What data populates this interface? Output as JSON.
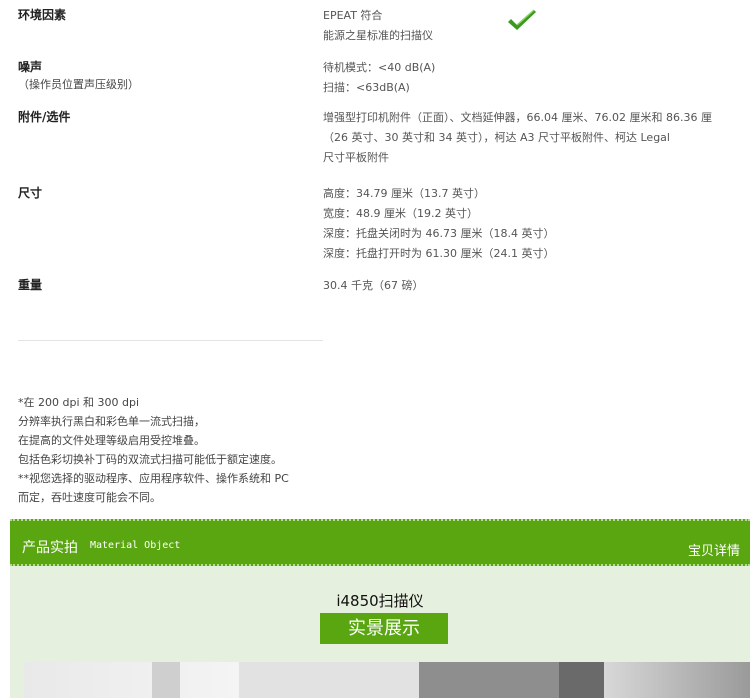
{
  "specs": {
    "env": {
      "label": "环境因素",
      "lines": [
        "EPEAT 符合",
        "能源之星标准的扫描仪"
      ],
      "icon": "checkmark-icon",
      "icon_color": "#3a9a1e"
    },
    "noise": {
      "label": "噪声",
      "sublabel": "（操作员位置声压级别）",
      "lines": [
        "待机模式：<40 dB(A)",
        "扫描：<63dB(A)"
      ]
    },
    "accessories": {
      "label": "附件/选件",
      "lines": [
        "增强型打印机附件（正面）、文档延伸器，66.04 厘米、76.02 厘米和 86.36 厘",
        "（26 英寸、30 英寸和 34 英寸），柯达 A3 尺寸平板附件、柯达 Legal",
        "尺寸平板附件"
      ]
    },
    "dimensions": {
      "label": "尺寸",
      "lines": [
        "高度：34.79 厘米（13.7 英寸）",
        "宽度：48.9 厘米（19.2 英寸）",
        "深度：托盘关闭时为 46.73 厘米（18.4 英寸）",
        "深度：托盘打开时为 61.30 厘米（24.1 英寸）"
      ]
    },
    "weight": {
      "label": "重量",
      "lines": [
        "30.4 千克（67 磅）"
      ]
    }
  },
  "notes": [
    "*在 200 dpi 和 300 dpi",
    "分辨率执行黑白和彩色单一流式扫描，",
    "在提高的文件处理等级启用受控堆叠。",
    "包括色彩切换补丁码的双流式扫描可能低于额定速度。",
    "**视您选择的驱动程序、应用程序软件、操作系统和 PC",
    "而定，吞吐速度可能会不同。"
  ],
  "section": {
    "title": "产品实拍",
    "subtitle": "Material Object",
    "right_link": "宝贝详情",
    "product_name": "i4850扫描仪",
    "button_label": "实景展示",
    "accent_color": "#59a611",
    "band_color": "#e6f0df"
  }
}
